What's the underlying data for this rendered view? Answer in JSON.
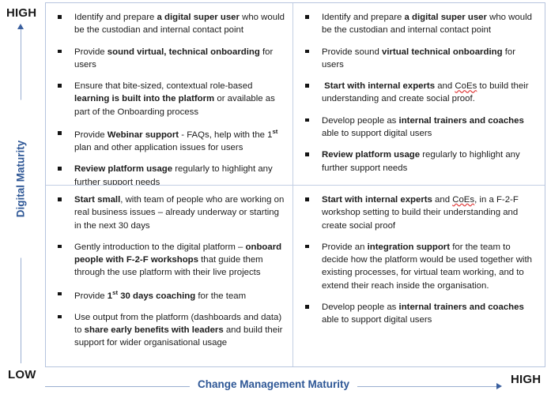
{
  "axes": {
    "vertical": {
      "label": "Digital Maturity",
      "high_label": "HIGH",
      "low_label": "LOW",
      "arrow": "up-arrow-icon",
      "color": "#2e5796"
    },
    "horizontal": {
      "label": "Change Management Maturity",
      "high_label": "HIGH",
      "arrow": "right-arrow-icon",
      "color": "#2e5796"
    }
  },
  "matrix": {
    "border_color": "#b6c4de",
    "divider_color": "#c3cfe4",
    "quadrants": [
      {
        "id": "top-left",
        "position": "low-change-high-digital",
        "bullets": [
          "Identify and prepare <b>a digital super user</b> who would be the custodian and internal contact point",
          "Provide <b>sound virtual, technical onboarding</b> for users",
          "Ensure that bite-sized, contextual role-based <b>learning is built into the platform</b> or available as part of the Onboarding process",
          "Provide <b>Webinar support</b> - FAQs, help with the 1<span class=\"sup\">st</span> plan and other application issues for users",
          "<b>Review platform usage</b> regularly to highlight any further support needs"
        ]
      },
      {
        "id": "top-right",
        "position": "high-change-high-digital",
        "bullets": [
          "Identify and prepare <b>a digital super user</b> who would be the custodian and internal contact point",
          "Provide sound <b>virtual technical onboarding</b> for users",
          "<b>&nbsp;Start with internal experts</b> and <span class=\"misspelled\">CoEs</span> to build their understanding and create social proof.",
          "Develop people as <b>internal trainers and coaches</b> able to support digital users",
          "<b>Review platform usage</b> regularly to highlight any further support needs"
        ]
      },
      {
        "id": "bottom-left",
        "position": "low-change-low-digital",
        "bullets": [
          "<b>Start small</b>, with team of people who are working on real business issues &ndash; already underway or starting in the next 30 days",
          "Gently introduction to the digital platform &ndash; <b>onboard people with F-2-F workshops</b> that guide them through the use platform with their live projects",
          "Provide <b>1<span class=\"sup\">st</span> 30 days coaching</b> for the team",
          "Use output from the platform (dashboards and data) to <b>share early benefits with leaders</b> and build their support for wider organisational usage"
        ]
      },
      {
        "id": "bottom-right",
        "position": "high-change-low-digital",
        "bullets": [
          "<b>Start with internal experts</b> and <span class=\"misspelled\">CoEs</span>, in a F-2-F workshop setting to build their understanding and create social proof",
          "Provide an <b>integration support</b> for the team to decide how the platform would be used together with existing processes, for virtual team working, and to extend their reach inside the organisation.",
          "Develop people as <b>internal trainers and coaches</b> able to support digital users"
        ]
      }
    ]
  }
}
